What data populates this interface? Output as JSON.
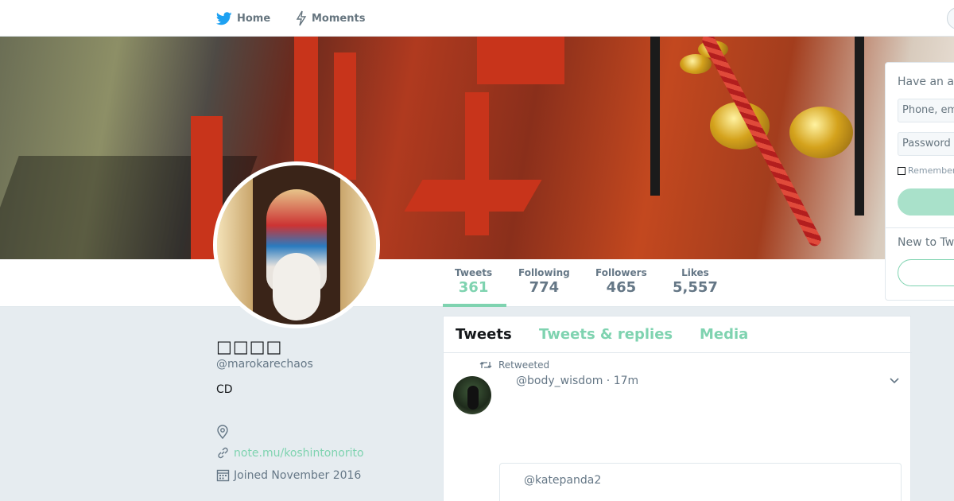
{
  "nav": {
    "home_label": "Home",
    "moments_label": "Moments",
    "brand_color": "#1da1f2"
  },
  "profile_nav": {
    "stats": [
      {
        "label": "Tweets",
        "value": "361",
        "active": true
      },
      {
        "label": "Following",
        "value": "774"
      },
      {
        "label": "Followers",
        "value": "465"
      },
      {
        "label": "Likes",
        "value": "5,557"
      }
    ],
    "accent_color": "#7fd3b0"
  },
  "profile": {
    "name": "□□□□",
    "handle": "@marokarechaos",
    "bio": "CD",
    "url": "note.mu/koshintonorito",
    "joined": "Joined November 2016"
  },
  "login": {
    "title": "Have an account?",
    "username_placeholder": "Phone, email or username",
    "password_placeholder": "Password",
    "remember_label": "Remember me",
    "new_prompt": "New to Twitter?"
  },
  "timeline": {
    "tabs": [
      {
        "label": "Tweets",
        "active": true
      },
      {
        "label": "Tweets & replies"
      },
      {
        "label": "Media"
      }
    ],
    "tweets": [
      {
        "retweet_label": "Retweeted",
        "header": "@body_wisdom · 17m",
        "quoted_handle": "@katepanda2"
      }
    ]
  }
}
